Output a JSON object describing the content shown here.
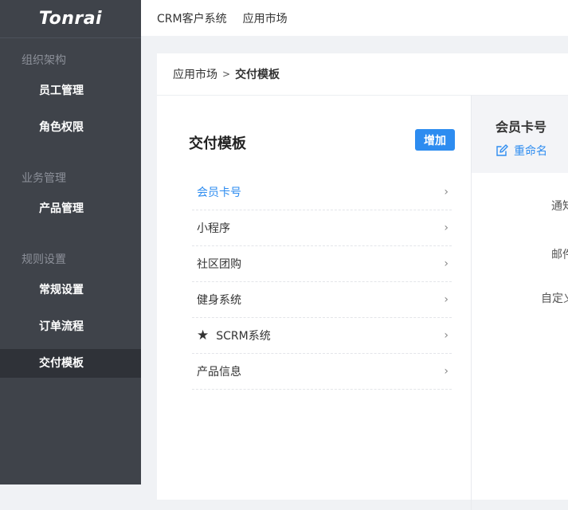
{
  "logo": {
    "text": "Tonrai"
  },
  "sidebar": {
    "groups": [
      {
        "title": "组织架构",
        "items": [
          "员工管理",
          "角色权限"
        ]
      },
      {
        "title": "业务管理",
        "items": [
          "产品管理"
        ]
      },
      {
        "title": "规则设置",
        "items": [
          "常规设置",
          "订单流程",
          "交付模板"
        ]
      }
    ],
    "active_item": "交付模板"
  },
  "topbar": {
    "links": [
      "CRM客户系统",
      "应用市场"
    ]
  },
  "breadcrumb": {
    "parent": "应用市场",
    "separator": ">",
    "current": "交付模板"
  },
  "template_panel": {
    "title": "交付模板",
    "add_label": "增加",
    "items": [
      {
        "label": "会员卡号",
        "active": true,
        "icon": null
      },
      {
        "label": "小程序",
        "active": false,
        "icon": null
      },
      {
        "label": "社区团购",
        "active": false,
        "icon": null
      },
      {
        "label": "健身系统",
        "active": false,
        "icon": null
      },
      {
        "label": "SCRM系统",
        "active": false,
        "icon": "star-icon"
      },
      {
        "label": "产品信息",
        "active": false,
        "icon": null
      }
    ]
  },
  "detail_panel": {
    "title": "会员卡号",
    "rename_label": "重命名",
    "fields": [
      "通知",
      "邮件",
      "自定义"
    ]
  },
  "colors": {
    "sidebar_bg": "#3f434a",
    "sidebar_active": "#2f3238",
    "accent": "#2d8cf0"
  }
}
